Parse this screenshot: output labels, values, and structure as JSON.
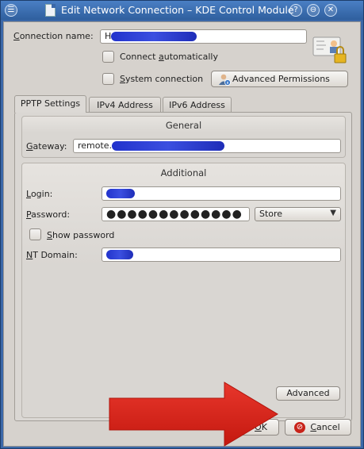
{
  "window": {
    "title": "Edit Network Connection – KDE Control Module",
    "help_glyph": "?",
    "minimize_glyph": "⊖",
    "close_glyph": "✕",
    "menu_glyph": "☰"
  },
  "connection": {
    "name_label_first": "C",
    "name_label_rest": "onnection name:",
    "name_value": "H",
    "connect_auto_pre": "Connect ",
    "connect_auto_u": "a",
    "connect_auto_post": "utomatically",
    "system_pre": "",
    "system_u": "S",
    "system_post": "ystem connection",
    "advanced_permissions": "Advanced Permissions"
  },
  "tabs": [
    {
      "label": "PPTP Settings",
      "active": true
    },
    {
      "label": "IPv4 Address",
      "active": false
    },
    {
      "label": "IPv6 Address",
      "active": false
    }
  ],
  "general": {
    "title": "General",
    "gateway_label_u": "G",
    "gateway_label_rest": "ateway:",
    "gateway_value": "remote."
  },
  "additional": {
    "title": "Additional",
    "login_label_u": "L",
    "login_label_rest": "ogin:",
    "password_label_u": "P",
    "password_label_rest": "assword:",
    "password_dots": "●●●●●●●●●●●●●",
    "password_store": "Store",
    "show_password_u": "S",
    "show_password_rest": "how password",
    "ntdomain_label_u": "N",
    "ntdomain_label_rest": "T Domain:"
  },
  "buttons": {
    "advanced": "Advanced",
    "ok_u": "O",
    "ok_rest": "K",
    "cancel_u": "C",
    "cancel_rest": "ancel"
  },
  "colors": {
    "title_bar": "#3b68a8",
    "dialog_bg": "#d6d2cd",
    "redaction": "#2233cc",
    "annotation_arrow": "#d8211b"
  }
}
